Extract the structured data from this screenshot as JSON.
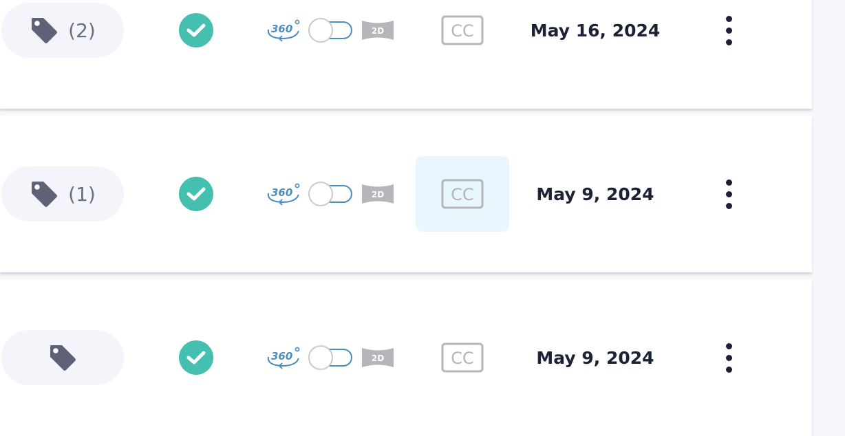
{
  "rows": [
    {
      "tag_count": "(2)",
      "toggle_badge": "2D",
      "mode_icon_label": "360",
      "cc_label": "CC",
      "date": "May 16, 2024",
      "cc_highlight": false
    },
    {
      "tag_count": "(1)",
      "toggle_badge": "2D",
      "mode_icon_label": "360",
      "cc_label": "CC",
      "date": "May 9, 2024",
      "cc_highlight": true
    },
    {
      "tag_count": "",
      "toggle_badge": "2D",
      "mode_icon_label": "360",
      "cc_label": "CC",
      "date": "May 9, 2024",
      "cc_highlight": false
    }
  ],
  "icons": {
    "tag": "tag-icon",
    "status": "check-circle-icon",
    "mode_360": "rotate-360-icon",
    "mode_2d": "flat-2d-icon",
    "captions": "closed-captions-icon",
    "more": "kebab-menu-icon"
  },
  "colors": {
    "tag_icon": "#5f6276",
    "check_bg": "#45bfb0",
    "accent_blue": "#4a8ec0",
    "grey_icon": "#b5b5ba",
    "text_dark": "#1b2236",
    "cc_highlight_bg": "#e8f6fd"
  }
}
